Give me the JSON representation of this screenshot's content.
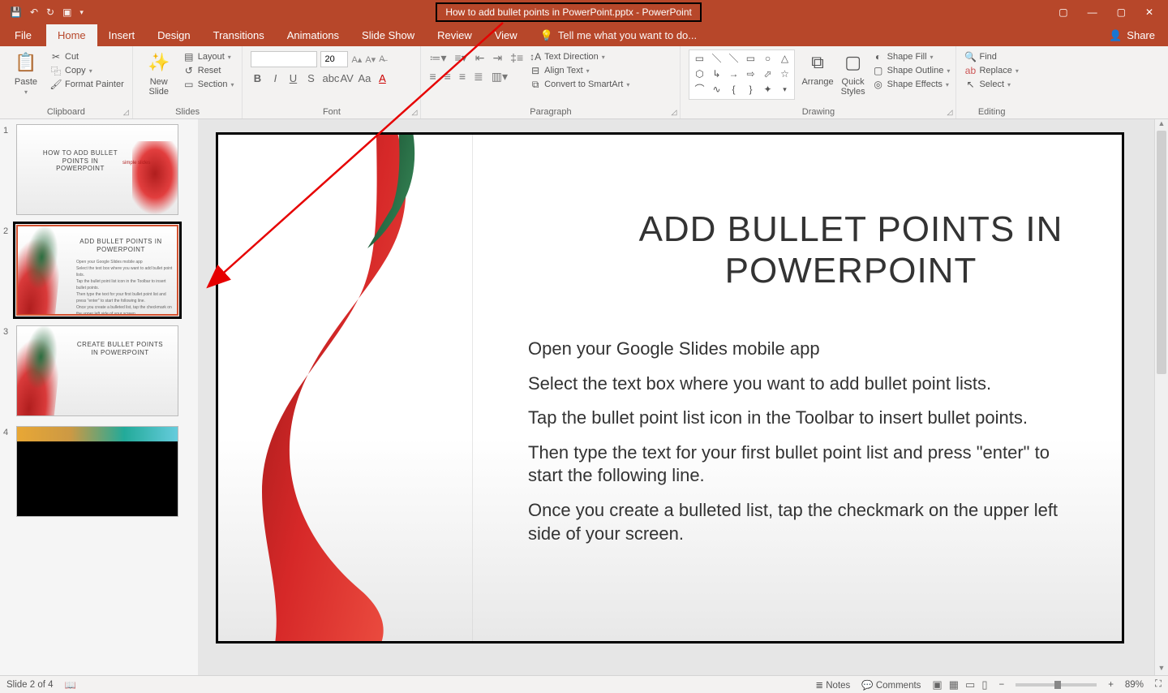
{
  "title_bar": {
    "title": "How to add bullet points in PowerPoint.pptx - PowerPoint"
  },
  "tabs": {
    "file": "File",
    "items": [
      "Home",
      "Insert",
      "Design",
      "Transitions",
      "Animations",
      "Slide Show",
      "Review",
      "View"
    ],
    "active": "Home",
    "tell_me": "Tell me what you want to do...",
    "share": "Share"
  },
  "ribbon": {
    "clipboard": {
      "label": "Clipboard",
      "paste": "Paste",
      "cut": "Cut",
      "copy": "Copy",
      "format_painter": "Format Painter"
    },
    "slides": {
      "label": "Slides",
      "new_slide": "New\nSlide",
      "layout": "Layout",
      "reset": "Reset",
      "section": "Section"
    },
    "font": {
      "label": "Font",
      "name": "",
      "size": "20"
    },
    "paragraph": {
      "label": "Paragraph",
      "text_direction": "Text Direction",
      "align_text": "Align Text",
      "convert_smartart": "Convert to SmartArt"
    },
    "drawing": {
      "label": "Drawing",
      "arrange": "Arrange",
      "quick_styles": "Quick\nStyles",
      "shape_fill": "Shape Fill",
      "shape_outline": "Shape Outline",
      "shape_effects": "Shape Effects"
    },
    "editing": {
      "label": "Editing",
      "find": "Find",
      "replace": "Replace",
      "select": "Select"
    }
  },
  "thumbnails": [
    {
      "num": "1",
      "title": "HOW TO ADD\nBULLET POINTS IN\nPOWERPOINT",
      "brand": "simple slides"
    },
    {
      "num": "2",
      "title": "ADD BULLET POINTS IN\nPOWERPOINT",
      "selected": true
    },
    {
      "num": "3",
      "title": "CREATE BULLET POINTS IN\nPOWERPOINT"
    },
    {
      "num": "4",
      "dark": true
    }
  ],
  "slide": {
    "title": "ADD BULLET POINTS IN POWERPOINT",
    "items": [
      "Open your Google Slides mobile app",
      "Select the text box where you want to add bullet point lists.",
      "Tap the bullet point list icon in the Toolbar to insert bullet points.",
      "Then type the text for your first bullet point list and press \"enter\" to start the following line.",
      "Once you create a bulleted list, tap the checkmark on the upper left side of your screen."
    ]
  },
  "status": {
    "slide_info": "Slide 2 of 4",
    "notes": "Notes",
    "comments": "Comments",
    "zoom": "89%"
  }
}
